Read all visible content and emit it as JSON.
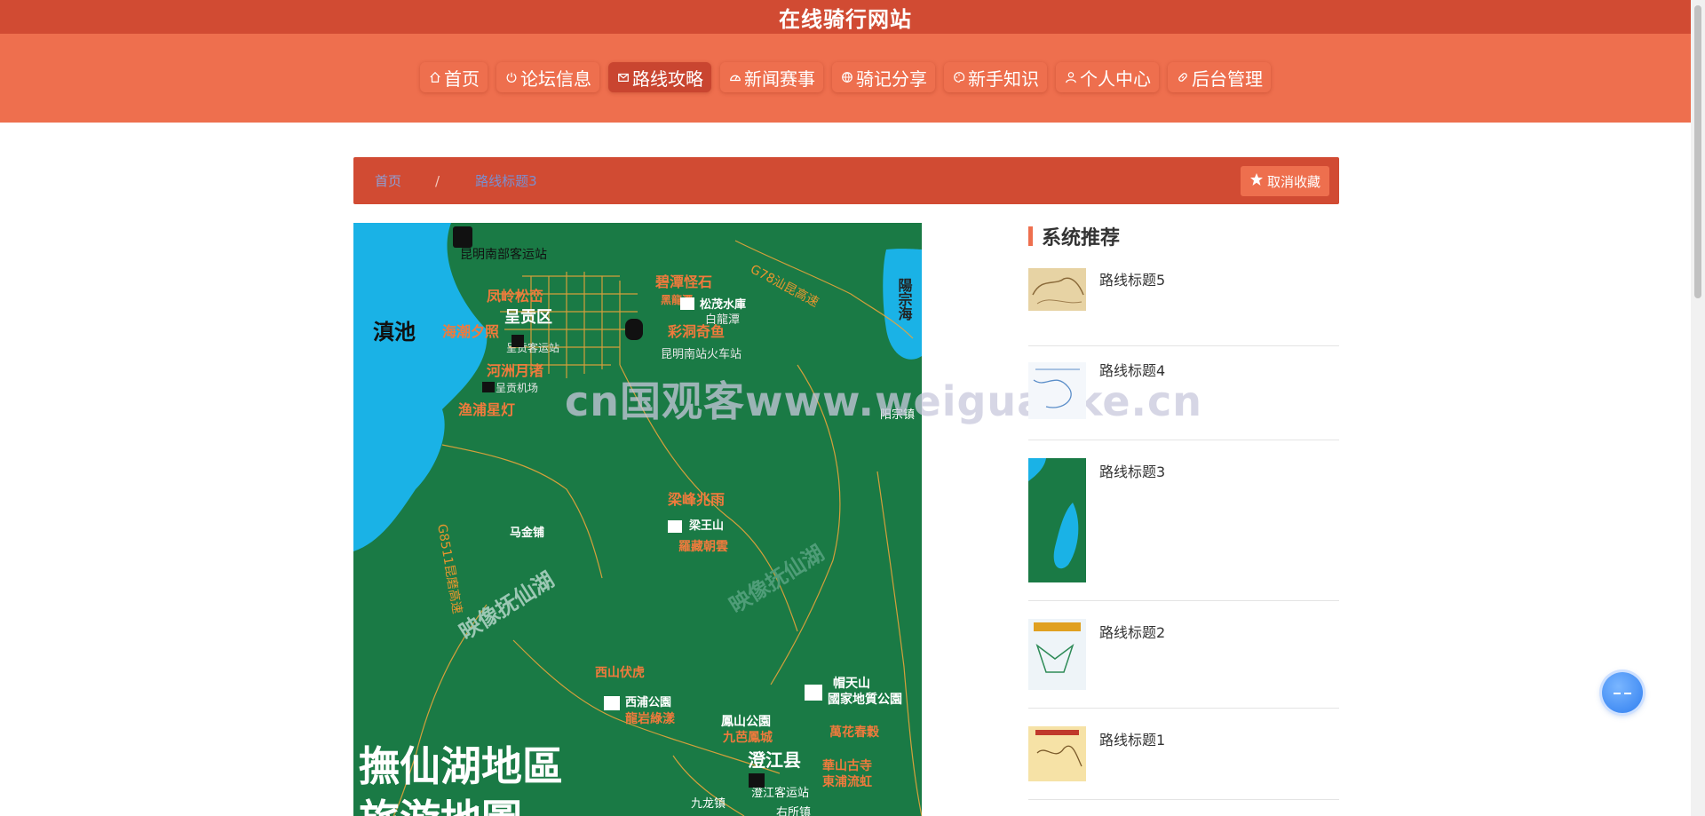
{
  "site": {
    "title": "在线骑行网站"
  },
  "nav": {
    "items": [
      {
        "label": "首页",
        "icon": "home-icon"
      },
      {
        "label": "论坛信息",
        "icon": "power-icon"
      },
      {
        "label": "路线攻略",
        "icon": "mail-icon",
        "active": true
      },
      {
        "label": "新闻赛事",
        "icon": "dashboard-icon"
      },
      {
        "label": "骑记分享",
        "icon": "globe-icon"
      },
      {
        "label": "新手知识",
        "icon": "palette-icon"
      },
      {
        "label": "个人中心",
        "icon": "user-icon"
      },
      {
        "label": "后台管理",
        "icon": "link-icon"
      }
    ]
  },
  "breadcrumb": {
    "home": "首页",
    "separator": "/",
    "current": "路线标题3"
  },
  "favorite_button": {
    "label": "取消收藏",
    "icon": "star-icon"
  },
  "map": {
    "labels": {
      "dianchi": "滇池",
      "yangzonghai": "陽宗海",
      "kunming_bus": "昆明南部客运站",
      "fengling": "凤岭松峦",
      "chenggong": "呈贡区",
      "haichao": "海潮夕照",
      "chenggong_bus": "呈贡客运站",
      "hezhou": "河洲月渚",
      "chenggong_airport": "呈贡机场",
      "yupu": "渔浦星灯",
      "bitan": "碧潭怪石",
      "heilongtan": "黑龍潭",
      "songmao": "松茂水庫",
      "bailongtan": "白龍潭",
      "caidong": "彩洞奇鱼",
      "kunming_south_rail": "昆明南站火车站",
      "g78": "G78汕昆高速",
      "yangzong_town": "阳宗镇",
      "liangfeng": "梁峰兆雨",
      "liangwang": "梁王山",
      "luozang": "羅藏朝雲",
      "majinpu": "马金铺",
      "g8511": "G8511昆磨高速",
      "film1": "映像抚仙湖",
      "film2": "映像抚仙湖",
      "xishan": "西山伏虎",
      "xipu": "西浦公園",
      "longyan": "龍岩綠漾",
      "maotian1": "帽天山",
      "maotian2": "國家地質公園",
      "fengshan": "鳳山公園",
      "jiupa": "九芭鳳城",
      "wanhua": "萬花春穀",
      "chengjiang": "澄江县",
      "huashan": "華山古寺",
      "dongpu": "東浦流虹",
      "chengjiang_bus": "澄江客运站",
      "jiulong": "九龙镇",
      "big1": "撫仙湖地區",
      "big2": "旅游地圖",
      "bottom_town": "右所镇"
    }
  },
  "watermark": "cn国观客www.weiguanke.cn",
  "sidebar": {
    "title": "系统推荐",
    "items": [
      {
        "name": "路线标题5"
      },
      {
        "name": "路线标题4"
      },
      {
        "name": "路线标题3"
      },
      {
        "name": "路线标题2"
      },
      {
        "name": "路线标题1"
      }
    ]
  },
  "colors": {
    "primary": "#d14b33",
    "nav_bg": "#ee6f4e",
    "map_green": "#1a7a45",
    "lake_blue": "#1ab2e6",
    "road_orange": "#e8962e"
  }
}
